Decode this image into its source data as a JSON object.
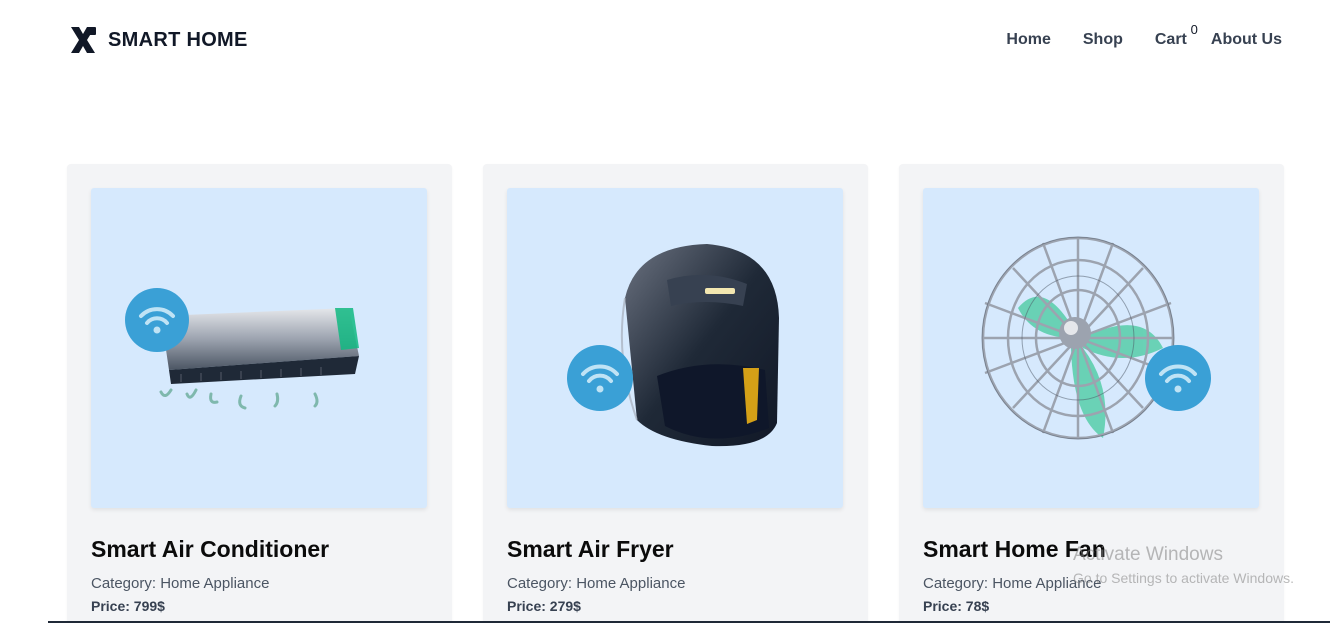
{
  "brand": {
    "name": "SMART HOME",
    "icon": "x-logo-icon"
  },
  "nav": {
    "home": "Home",
    "shop": "Shop",
    "cart": "Cart",
    "cart_count": "0",
    "about": "About Us"
  },
  "products": [
    {
      "title": "Smart Air Conditioner",
      "category": "Category: Home Appliance",
      "price": "Price: 799$",
      "image_icon": "air-conditioner-icon"
    },
    {
      "title": "Smart Air Fryer",
      "category": "Category: Home Appliance",
      "price": "Price: 279$",
      "image_icon": "air-fryer-icon"
    },
    {
      "title": "Smart Home Fan",
      "category": "Category: Home Appliance",
      "price": "Price: 78$",
      "image_icon": "fan-icon"
    }
  ],
  "watermark": {
    "line1": "Activate Windows",
    "line2": "Go to Settings to activate Windows."
  },
  "colors": {
    "card_bg": "#f3f4f6",
    "image_bg": "#d6e9fd",
    "wifi_badge": "#3aa0d6",
    "text_dark": "#111827"
  }
}
